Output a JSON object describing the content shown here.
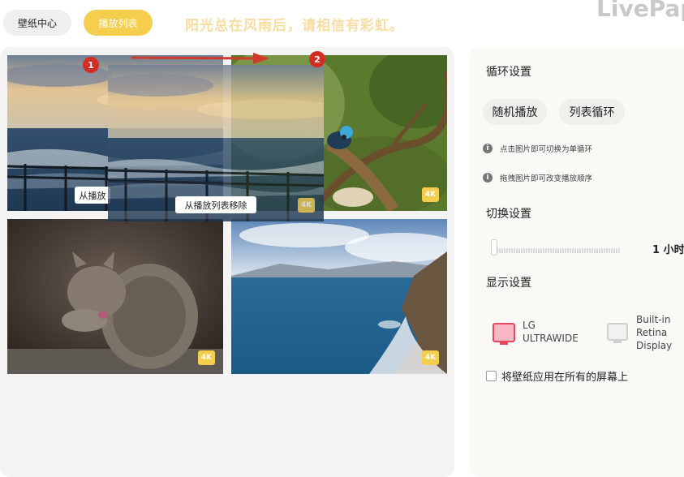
{
  "nav": {
    "wallpaper_center": "壁纸中心",
    "playlist": "播放列表"
  },
  "slogan": "阳光总在风雨后，请相信有彩虹。",
  "brand": "LivePap",
  "playlist": {
    "remove_label": "从播放列表移除",
    "remove_label_partial": "从播放",
    "badge": "4K",
    "steps": [
      "1",
      "2"
    ]
  },
  "settings": {
    "loop_title": "循环设置",
    "random_play": "随机播放",
    "list_loop": "列表循环",
    "hint_click": "点击图片即可切换为单循环",
    "hint_drag": "拖拽图片即可改变播放顺序",
    "switch_title": "切换设置",
    "interval_value": "1 小时",
    "interval_slider_level": 0,
    "display_title": "显示设置",
    "displays": [
      {
        "name_line1": "LG",
        "name_line2": "ULTRAWIDE",
        "name_line3": "",
        "selected": true
      },
      {
        "name_line1": "Built-in",
        "name_line2": "Retina",
        "name_line3": "Display",
        "selected": false
      }
    ],
    "apply_all_label": "将壁纸应用在所有的屏幕上",
    "apply_all_checked": false
  },
  "colors": {
    "accent": "#f5ce4e",
    "step_red": "#d42e24",
    "arrow_red": "#d0392b"
  }
}
